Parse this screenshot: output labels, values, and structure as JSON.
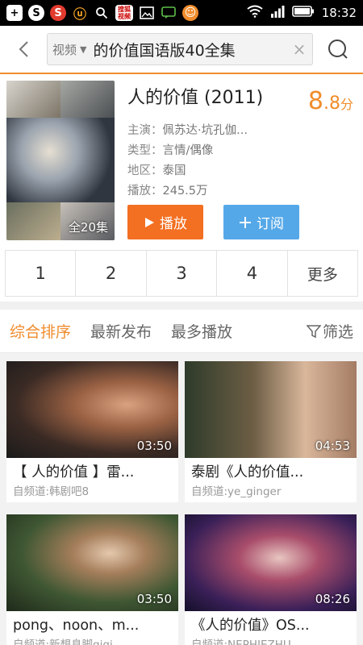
{
  "status_bar": {
    "icons": [
      "plus-icon",
      "s-icon",
      "sohu-icon",
      "uc-icon",
      "search-icon",
      "sohu-video-icon",
      "image-icon",
      "chat-icon",
      "smile-icon"
    ],
    "sohu_video_label": "搜狐\n视频",
    "time": "18:32"
  },
  "search": {
    "type_label": "视频",
    "query": "的价值国语版40全集"
  },
  "show": {
    "title": "人的价值 (2011)",
    "score_int": "8",
    "score_frac": ".8",
    "score_unit": "分",
    "actors_label": "主演：",
    "actors": "佩苏达·坑孔伽...",
    "type_label": "类型：",
    "type": "言情/偶像",
    "region_label": "地区：",
    "region": "泰国",
    "plays_label": "播放：",
    "plays": "245.5万",
    "episode_badge": "全20集",
    "play_button": "播放",
    "subscribe_button": "订阅"
  },
  "episodes": [
    "1",
    "2",
    "3",
    "4",
    "更多"
  ],
  "sort_tabs": [
    "综合排序",
    "最新发布",
    "最多播放"
  ],
  "filter_label": "筛选",
  "videos": [
    {
      "title": "【 人的价值 】雷...",
      "source": "自频道:韩剧吧8",
      "duration": "03:50"
    },
    {
      "title": "泰剧《人的价值...",
      "source": "自频道:ye_ginger",
      "duration": "04:53"
    },
    {
      "title": "pong、noon、m...",
      "source": "自频道:新想息脚gigi",
      "duration": "03:50"
    },
    {
      "title": "《人的价值》OS...",
      "source": "自频道:NEPHIEZHU",
      "duration": "08:26"
    }
  ],
  "colors": {
    "accent": "#f08c2c",
    "play_button": "#f36f21",
    "subscribe_button": "#55a8e8"
  }
}
